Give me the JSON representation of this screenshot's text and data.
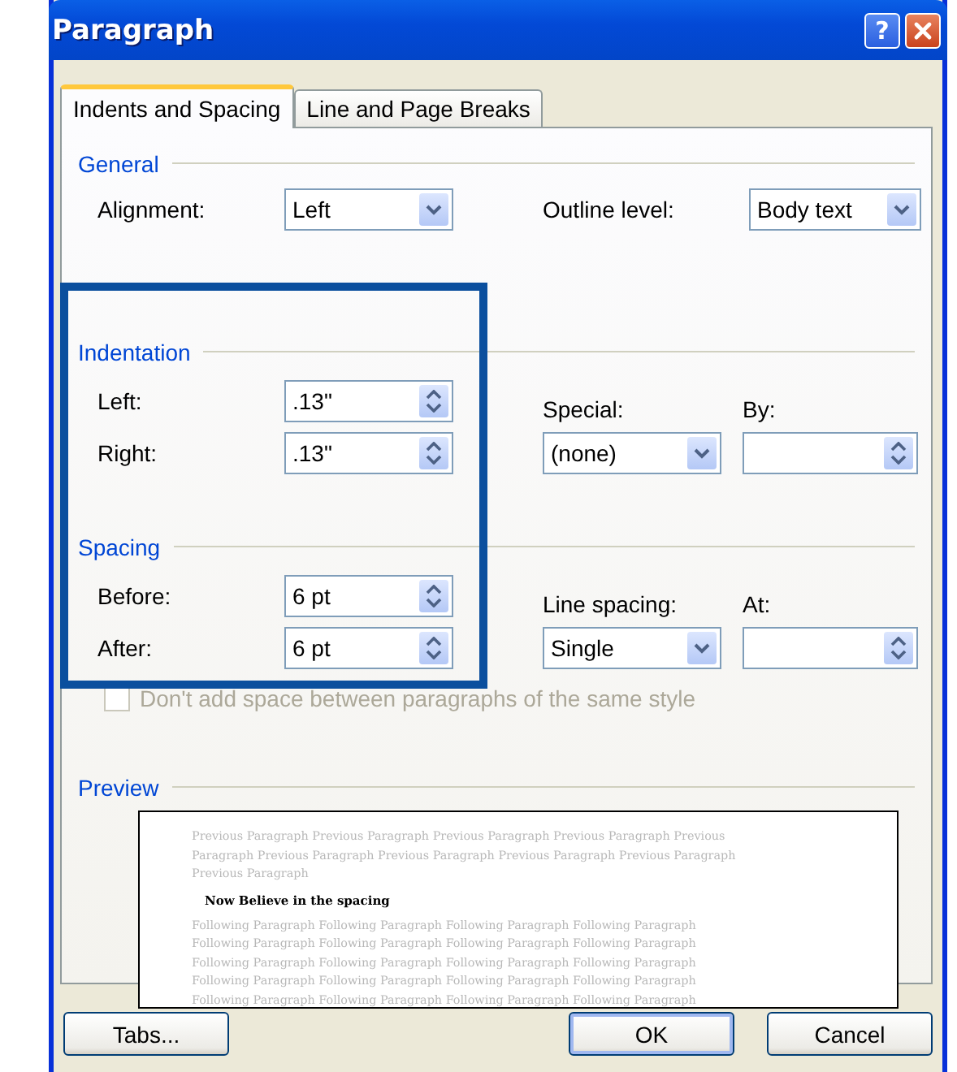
{
  "window": {
    "title": "Paragraph",
    "help_button": "?"
  },
  "tabs": [
    {
      "label": "Indents and Spacing",
      "selected": true
    },
    {
      "label": "Line and Page Breaks",
      "selected": false
    }
  ],
  "general": {
    "heading": "General",
    "alignment": {
      "label": "Alignment:",
      "value": "Left"
    },
    "outline_level": {
      "label": "Outline level:",
      "value": "Body text"
    }
  },
  "indentation": {
    "heading": "Indentation",
    "left": {
      "label": "Left:",
      "value": ".13\""
    },
    "right": {
      "label": "Right:",
      "value": ".13\""
    },
    "special": {
      "label": "Special:",
      "value": "(none)"
    },
    "by": {
      "label": "By:"
    }
  },
  "spacing": {
    "heading": "Spacing",
    "before": {
      "label": "Before:",
      "value": "6 pt"
    },
    "after": {
      "label": "After:",
      "value": "6 pt"
    },
    "line_spacing": {
      "label": "Line spacing:",
      "value": "Single"
    },
    "at": {
      "label": "At:"
    },
    "no_space_checkbox": {
      "label": "Don't add space between paragraphs of the same style",
      "checked": false,
      "disabled": true
    }
  },
  "preview": {
    "heading": "Preview",
    "previous_lines": [
      "Previous Paragraph Previous Paragraph Previous Paragraph Previous Paragraph Previous",
      "Paragraph Previous Paragraph Previous Paragraph Previous Paragraph Previous Paragraph",
      "Previous Paragraph"
    ],
    "sample": "Now Believe in the spacing",
    "following_lines": [
      "Following Paragraph Following Paragraph Following Paragraph Following Paragraph",
      "Following Paragraph Following Paragraph Following Paragraph Following Paragraph",
      "Following Paragraph Following Paragraph Following Paragraph Following Paragraph",
      "Following Paragraph Following Paragraph Following Paragraph Following Paragraph",
      "Following Paragraph Following Paragraph Following Paragraph Following Paragraph"
    ]
  },
  "buttons": [
    {
      "label": "Tabs...",
      "default": false
    },
    {
      "label": "OK",
      "default": true
    },
    {
      "label": "Cancel",
      "default": false
    }
  ]
}
